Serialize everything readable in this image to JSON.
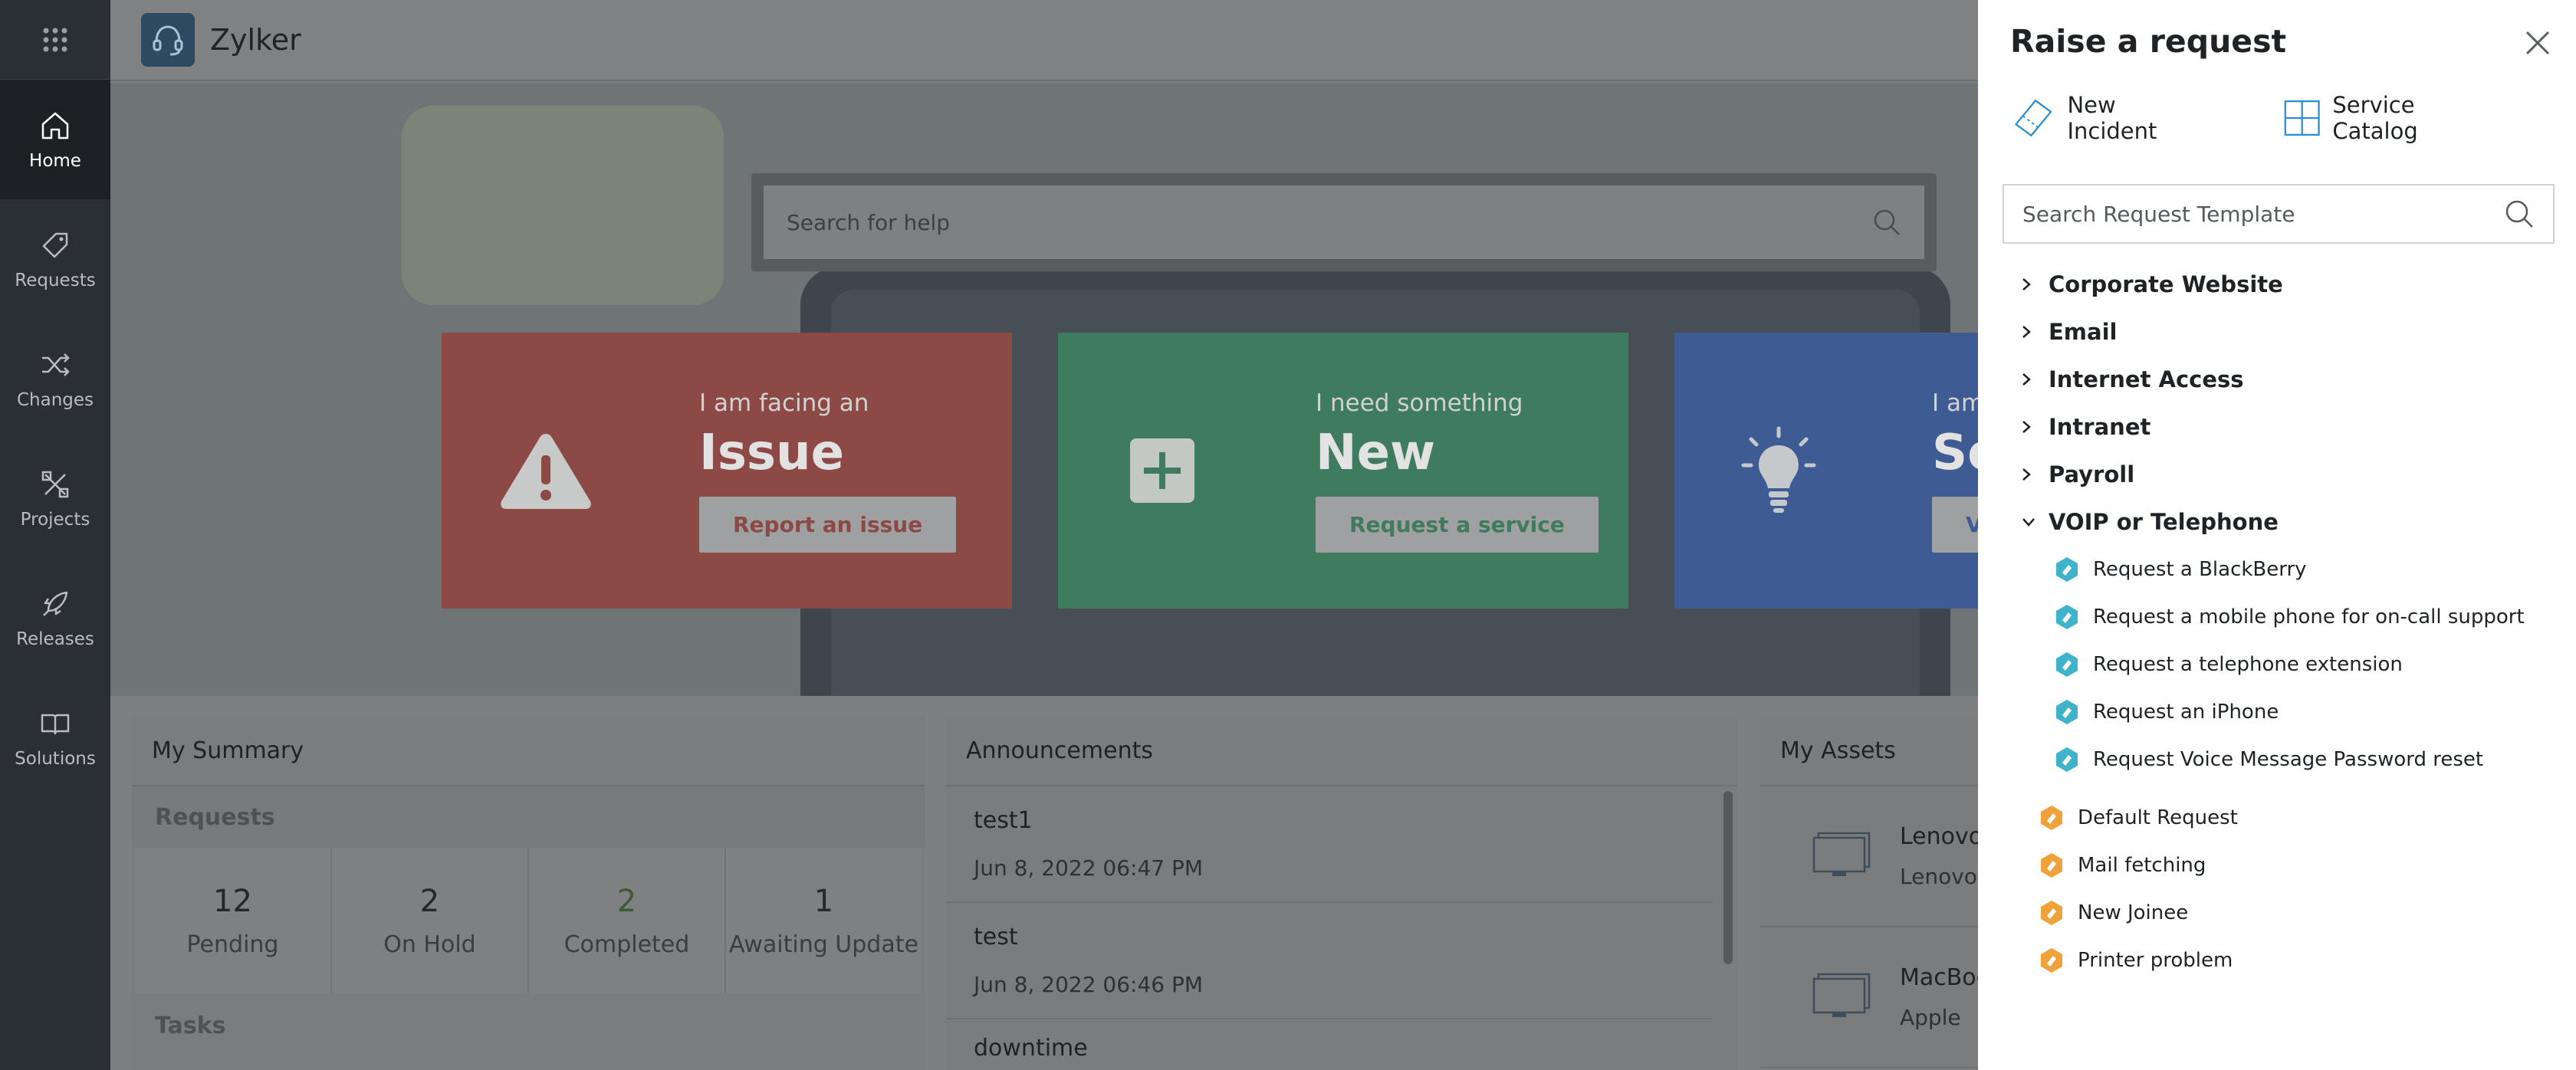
{
  "app": {
    "brand": "Zylker"
  },
  "nav": {
    "items": [
      {
        "label": "Home",
        "icon": "home-icon"
      },
      {
        "label": "Requests",
        "icon": "ticket-icon"
      },
      {
        "label": "Changes",
        "icon": "shuffle-icon"
      },
      {
        "label": "Projects",
        "icon": "projects-icon"
      },
      {
        "label": "Releases",
        "icon": "rocket-icon"
      },
      {
        "label": "Solutions",
        "icon": "book-icon"
      }
    ]
  },
  "hero": {
    "search_placeholder": "Search for help",
    "cards": [
      {
        "lead": "I am facing an",
        "big": "Issue",
        "button": "Report an issue",
        "icon": "warning-icon"
      },
      {
        "lead": "I need something",
        "big": "New",
        "button": "Request a service",
        "icon": "plus-icon"
      },
      {
        "lead": "I am lo",
        "big": "Solu",
        "button": "View",
        "icon": "lightbulb-icon"
      }
    ]
  },
  "summary": {
    "title": "My Summary",
    "requests_label": "Requests",
    "stats": [
      {
        "value": "12",
        "label": "Pending"
      },
      {
        "value": "2",
        "label": "On Hold"
      },
      {
        "value": "2",
        "label": "Completed"
      },
      {
        "value": "1",
        "label": "Awaiting Update"
      }
    ],
    "tasks_label": "Tasks"
  },
  "announcements": {
    "title": "Announcements",
    "items": [
      {
        "title": "test1",
        "date": "Jun 8, 2022 06:47 PM"
      },
      {
        "title": "test",
        "date": "Jun 8, 2022 06:46 PM"
      },
      {
        "title": "downtime",
        "date": ""
      }
    ]
  },
  "assets": {
    "title": "My Assets",
    "items": [
      {
        "name": "Lenovo",
        "maker": "Lenovo"
      },
      {
        "name": "MacBoo",
        "maker": "Apple"
      }
    ]
  },
  "drawer": {
    "title": "Raise a request",
    "tabs": [
      {
        "label": "New Incident",
        "icon": "ticket-icon"
      },
      {
        "label": "Service Catalog",
        "icon": "grid-icon"
      }
    ],
    "search_placeholder": "Search Request Template",
    "groups": [
      {
        "label": "Corporate Website",
        "expanded": false
      },
      {
        "label": "Email",
        "expanded": false
      },
      {
        "label": "Internet Access",
        "expanded": false
      },
      {
        "label": "Intranet",
        "expanded": false
      },
      {
        "label": "Payroll",
        "expanded": false
      },
      {
        "label": "VOIP or Telephone",
        "expanded": true
      }
    ],
    "voip_items": [
      "Request a BlackBerry",
      "Request a mobile phone for on-call support",
      "Request a telephone extension",
      "Request an iPhone",
      "Request Voice Message Password reset"
    ],
    "incident_templates": [
      "Default Request",
      "Mail fetching",
      "New Joinee",
      "Printer problem"
    ],
    "colors": {
      "service_icon": "#3fb3c9",
      "incident_icon": "#f0a23a"
    }
  }
}
